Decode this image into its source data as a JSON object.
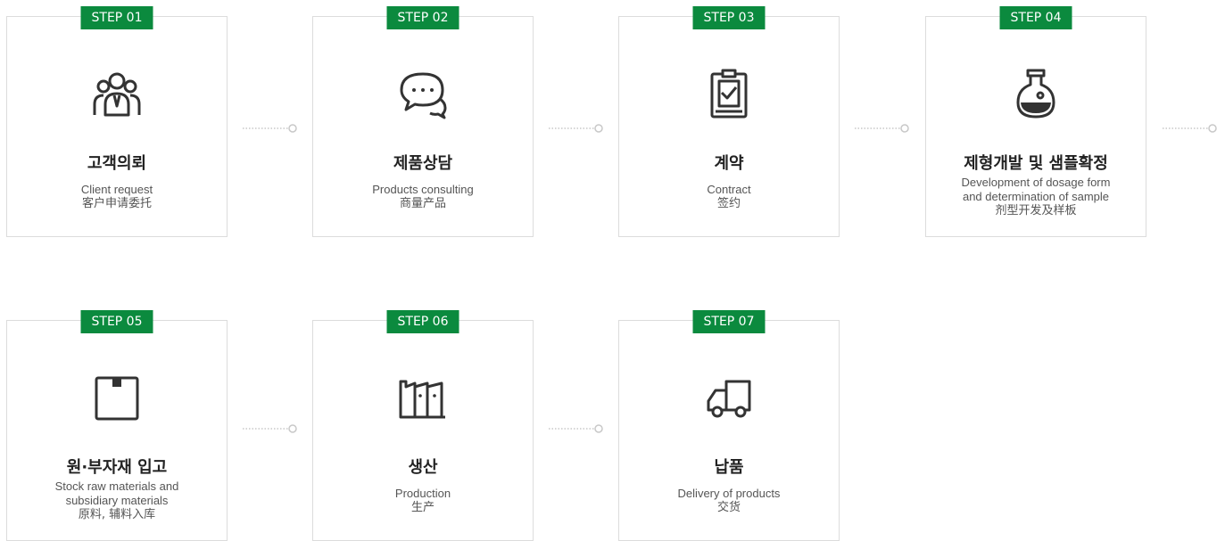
{
  "steps": [
    {
      "badge": "STEP 01",
      "title": "고객의뢰",
      "en": "Client request",
      "en2": "",
      "zh": "客户申请委托",
      "icon": "client-group-icon"
    },
    {
      "badge": "STEP 02",
      "title": "제품상담",
      "en": "Products consulting",
      "en2": "",
      "zh": "商量产品",
      "icon": "chat-bubble-icon"
    },
    {
      "badge": "STEP 03",
      "title": "계약",
      "en": "Contract",
      "en2": "",
      "zh": "签约",
      "icon": "clipboard-check-icon"
    },
    {
      "badge": "STEP 04",
      "title": "제형개발 및 샘플확정",
      "en": "Development of dosage form",
      "en2": "and determination of sample",
      "zh": "剂型开发及样板",
      "icon": "flask-icon"
    },
    {
      "badge": "STEP 05",
      "title": "원·부자재 입고",
      "en": "Stock raw materials and",
      "en2": "subsidiary materials",
      "zh": "原料, 辅料入库",
      "icon": "box-icon"
    },
    {
      "badge": "STEP 06",
      "title": "생산",
      "en": "Production",
      "en2": "",
      "zh": "生产",
      "icon": "factory-icon"
    },
    {
      "badge": "STEP 07",
      "title": "납품",
      "en": "Delivery of products",
      "en2": "",
      "zh": "交货",
      "icon": "truck-icon"
    }
  ],
  "colors": {
    "accent": "#0b8a3e",
    "icon": "#333333",
    "connector": "#c8c8c8"
  }
}
